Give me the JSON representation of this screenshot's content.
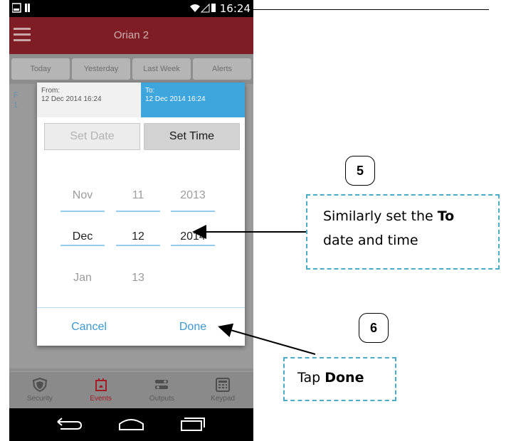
{
  "status_bar": {
    "time": "16:24"
  },
  "app": {
    "title": "Orian 2"
  },
  "filter_tabs": [
    "Today",
    "Yesterday",
    "Last Week",
    "Alerts"
  ],
  "background_fragment": [
    "F",
    "1"
  ],
  "dialog": {
    "from_label": "From:",
    "from_value": "12 Dec 2014  16:24",
    "to_label": "To:",
    "to_value": "12 Dec 2014  16:24",
    "set_date": "Set Date",
    "set_time": "Set Time",
    "month_col": [
      "Nov",
      "Dec",
      "Jan"
    ],
    "day_col": [
      "11",
      "12",
      "13"
    ],
    "year_col": [
      "2013",
      "2014",
      ""
    ],
    "cancel": "Cancel",
    "done": "Done"
  },
  "bottom_nav": [
    {
      "label": "Security",
      "icon": "shield-icon"
    },
    {
      "label": "Events",
      "icon": "bell-icon"
    },
    {
      "label": "Outputs",
      "icon": "outputs-icon"
    },
    {
      "label": "Keypad",
      "icon": "keypad-icon"
    }
  ],
  "annotations": {
    "step5": "5",
    "callout5_line1_pre": "Similarly set the ",
    "callout5_line1_bold": "To",
    "callout5_line2": "date and time",
    "step6": "6",
    "callout6_pre": "Tap ",
    "callout6_bold": "Done"
  },
  "colors": {
    "app_bar": "#7e1d24",
    "to_header": "#3ea5dd",
    "picker_line": "#93ccee",
    "dialog_button": "#3d98cf",
    "callout_border": "#4aacc6",
    "events_active": "#a11e26"
  }
}
